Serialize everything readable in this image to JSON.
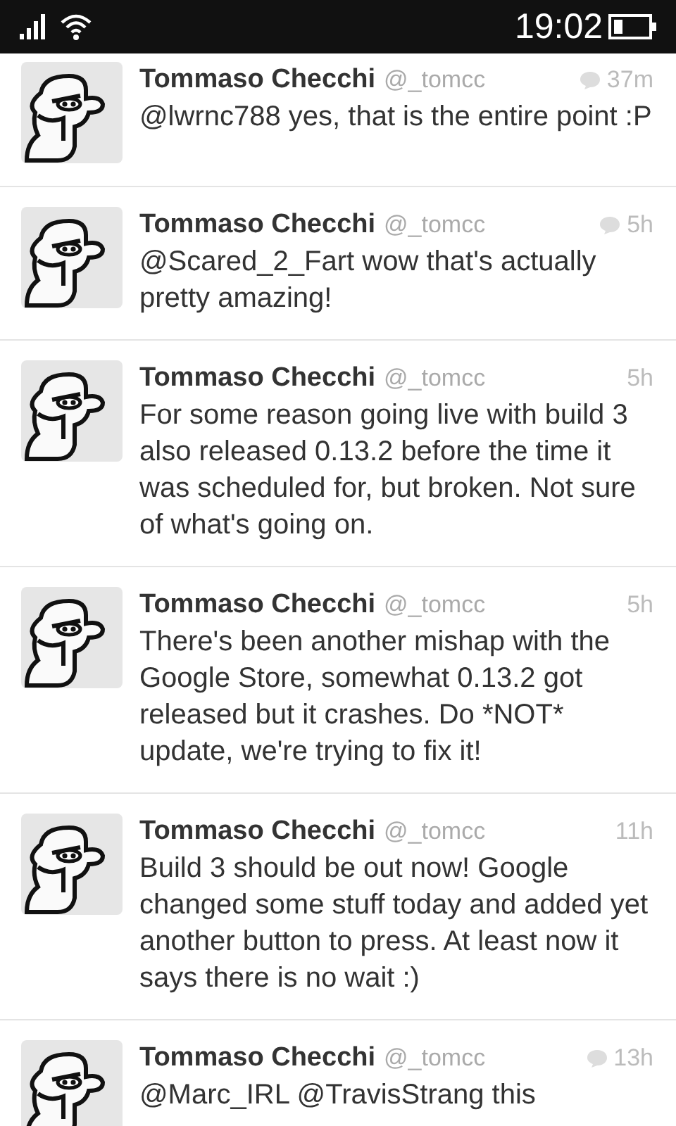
{
  "status_bar": {
    "time": "19:02"
  },
  "tweets": [
    {
      "name": "Tommaso Checchi",
      "handle": "@_tomcc",
      "time": "37m",
      "reply": true,
      "text": "@lwrnc788 yes, that is the entire point :P"
    },
    {
      "name": "Tommaso Checchi",
      "handle": "@_tomcc",
      "time": "5h",
      "reply": true,
      "text": "@Scared_2_Fart wow that's actually pretty amazing!"
    },
    {
      "name": "Tommaso Checchi",
      "handle": "@_tomcc",
      "time": "5h",
      "reply": false,
      "text": "For some reason going live with build 3 also released 0.13.2 before the time it was scheduled for, but broken. Not sure of what's going on."
    },
    {
      "name": "Tommaso Checchi",
      "handle": "@_tomcc",
      "time": "5h",
      "reply": false,
      "text": "There's been another mishap with the Google Store, somewhat 0.13.2 got released but it crashes. Do *NOT* update, we're trying to fix it!"
    },
    {
      "name": "Tommaso Checchi",
      "handle": "@_tomcc",
      "time": "11h",
      "reply": false,
      "text": "Build 3 should be out now! Google changed some stuff today and added yet another button to press. At least now it says there is no wait :)"
    },
    {
      "name": "Tommaso Checchi",
      "handle": "@_tomcc",
      "time": "13h",
      "reply": true,
      "text": "@Marc_IRL @TravisStrang this"
    }
  ]
}
